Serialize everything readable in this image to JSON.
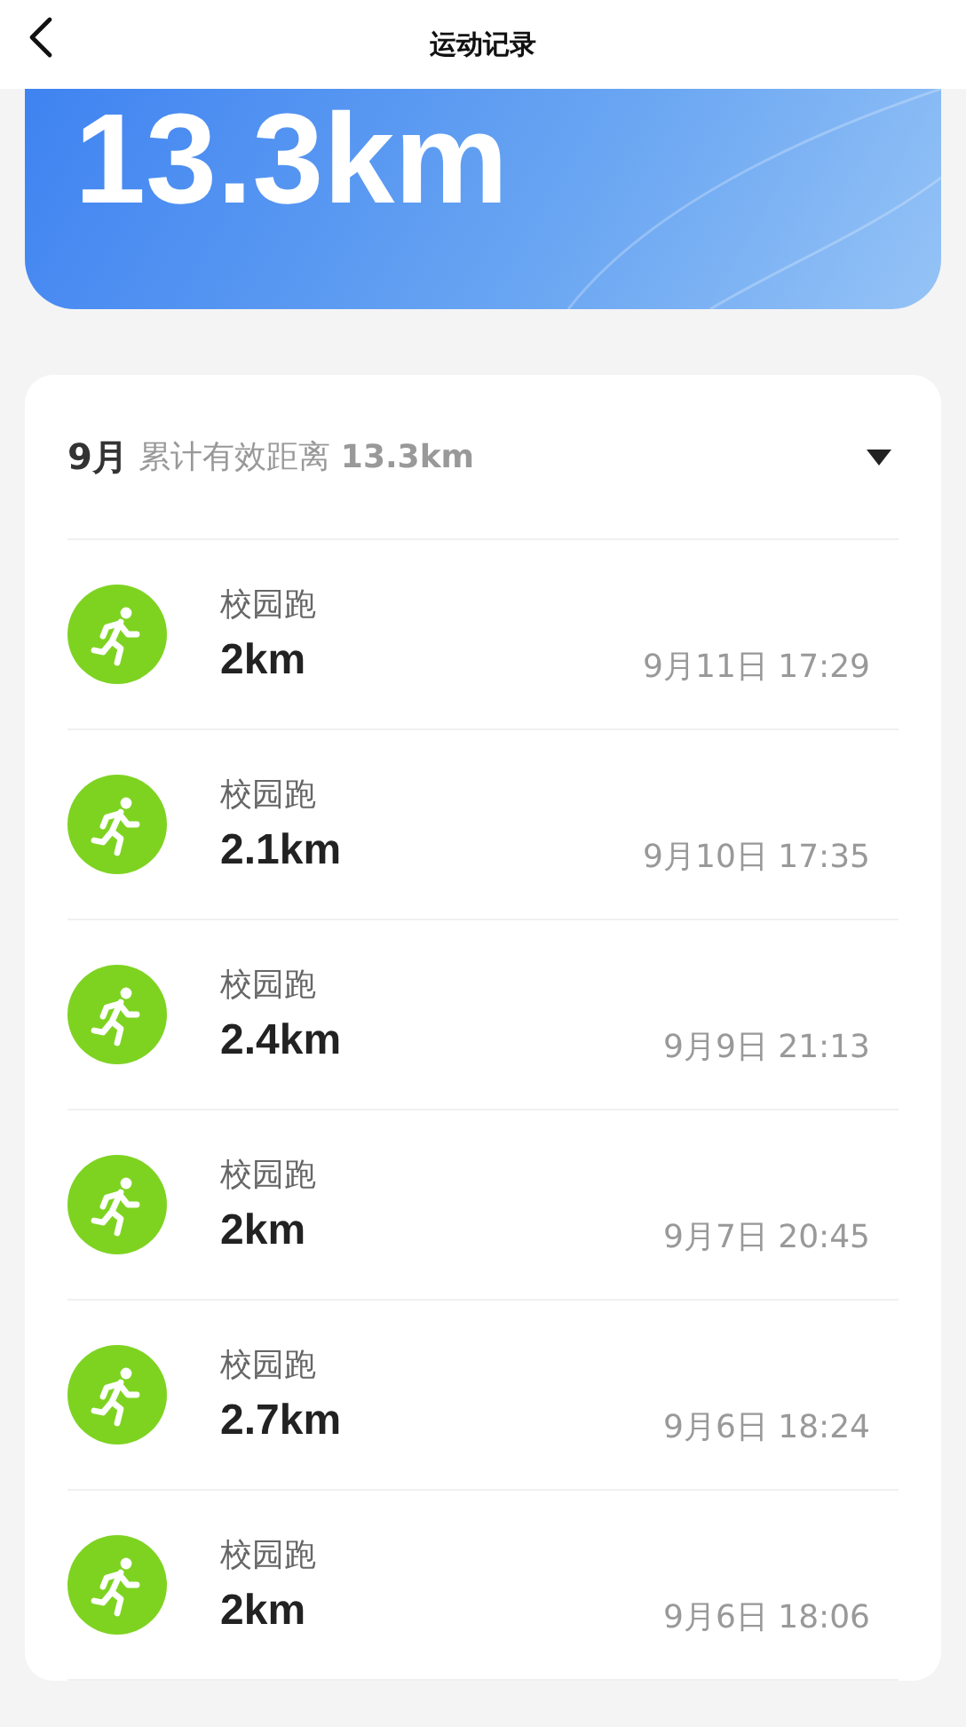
{
  "header": {
    "title": "运动记录"
  },
  "summary": {
    "total": "13.3km"
  },
  "month": {
    "label": "9月",
    "caption": "累计有效距离",
    "total": "13.3km",
    "expanded": true
  },
  "records": [
    {
      "type": "校园跑",
      "distance": "2km",
      "time": "9月11日 17:29"
    },
    {
      "type": "校园跑",
      "distance": "2.1km",
      "time": "9月10日 17:35"
    },
    {
      "type": "校园跑",
      "distance": "2.4km",
      "time": "9月9日 21:13"
    },
    {
      "type": "校园跑",
      "distance": "2km",
      "time": "9月7日 20:45"
    },
    {
      "type": "校园跑",
      "distance": "2.7km",
      "time": "9月6日 18:24"
    },
    {
      "type": "校园跑",
      "distance": "2km",
      "time": "9月6日 18:06"
    }
  ]
}
